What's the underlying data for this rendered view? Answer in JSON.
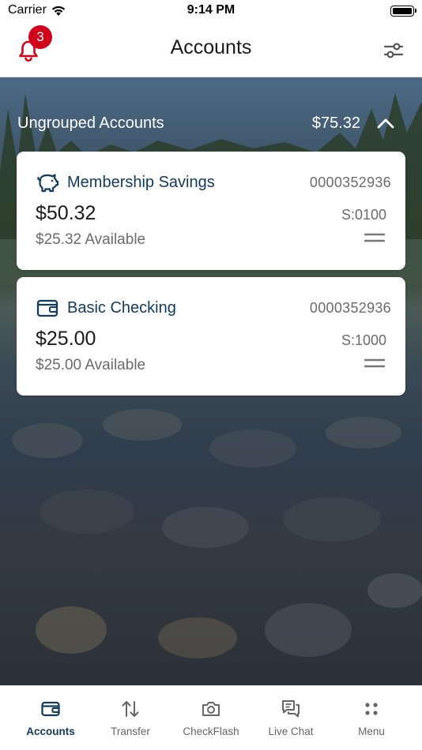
{
  "status_bar": {
    "carrier": "Carrier",
    "time": "9:14 PM"
  },
  "header": {
    "title": "Accounts",
    "notification_count": "3",
    "icons": [
      "bell-icon",
      "filter-sliders-icon"
    ]
  },
  "group": {
    "title": "Ungrouped Accounts",
    "total": "$75.32",
    "expanded": true
  },
  "accounts": [
    {
      "name": "Membership Savings",
      "icon": "piggy-bank-icon",
      "number": "0000352936",
      "balance": "$50.32",
      "suffix": "S:0100",
      "available": "$25.32 Available"
    },
    {
      "name": "Basic Checking",
      "icon": "wallet-icon",
      "number": "0000352936",
      "balance": "$25.00",
      "suffix": "S:1000",
      "available": "$25.00 Available"
    }
  ],
  "tabs": [
    {
      "label": "Accounts",
      "icon": "wallet-icon",
      "active": true
    },
    {
      "label": "Transfer",
      "icon": "transfer-arrows-icon",
      "active": false
    },
    {
      "label": "CheckFlash",
      "icon": "camera-icon",
      "active": false
    },
    {
      "label": "Live Chat",
      "icon": "chat-icon",
      "active": false
    },
    {
      "label": "Menu",
      "icon": "dots-grid-icon",
      "active": false
    }
  ],
  "colors": {
    "accent_navy": "#123a5c",
    "alert_red": "#d0021b",
    "text_gray": "#6b6b6b"
  }
}
